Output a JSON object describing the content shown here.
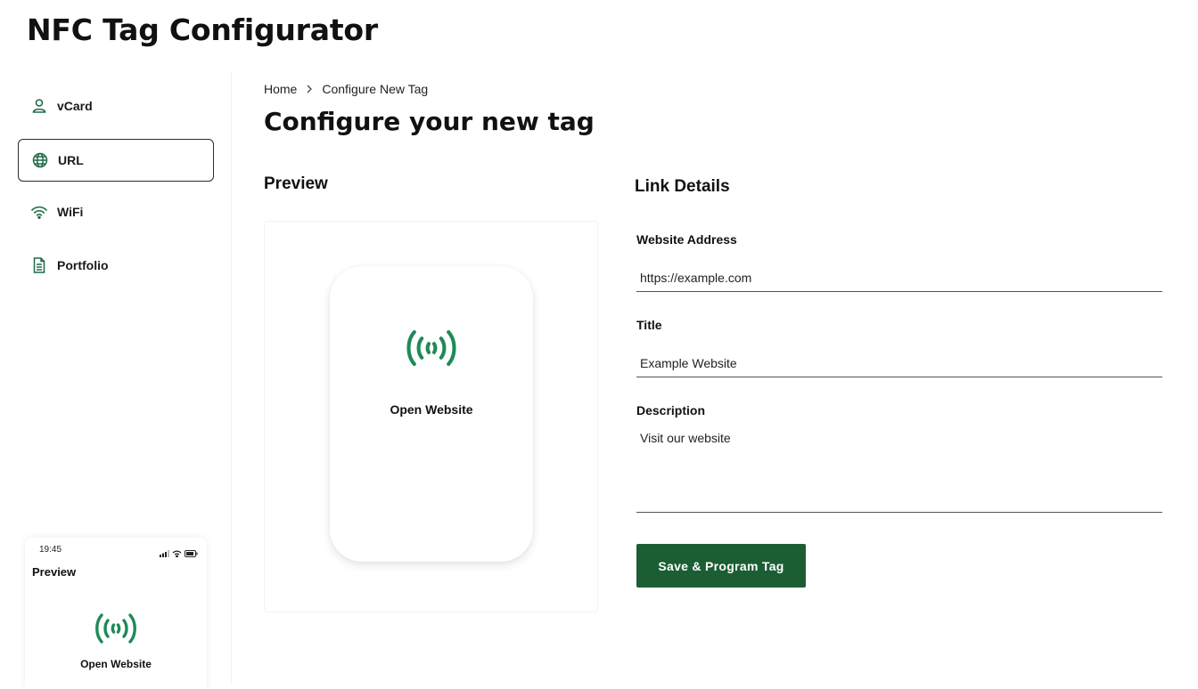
{
  "app": {
    "title": "NFC Tag Configurator"
  },
  "sidebar": {
    "items": [
      {
        "label": "vCard",
        "icon": "user-icon"
      },
      {
        "label": "URL",
        "icon": "globe-icon",
        "active": true
      },
      {
        "label": "WiFi",
        "icon": "wifi-icon"
      },
      {
        "label": "Portfolio",
        "icon": "document-icon"
      }
    ]
  },
  "mini_preview": {
    "time": "19:45",
    "title": "Preview",
    "label": "Open Website"
  },
  "breadcrumb": {
    "home": "Home",
    "separator": ">",
    "current": "Configure New Tag"
  },
  "page": {
    "title": "Configure your new tag"
  },
  "preview": {
    "title": "Preview",
    "label": "Open Website"
  },
  "form": {
    "title": "Link Details",
    "website": {
      "label": "Website Address",
      "value": "https://example.com"
    },
    "name": {
      "label": "Title",
      "value": "Example Website"
    },
    "description": {
      "label": "Description",
      "value": "Visit our website"
    },
    "save_label": "Save & Program Tag"
  },
  "colors": {
    "accent": "#1e8a57",
    "button": "#1c5e33"
  }
}
